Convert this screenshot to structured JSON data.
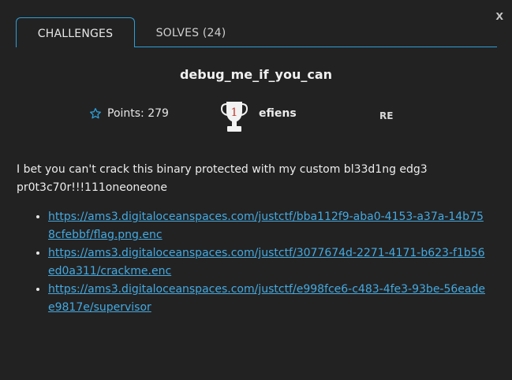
{
  "modal": {
    "close_label": "x",
    "tabs": [
      {
        "label": "CHALLENGES"
      },
      {
        "label": "SOLVES (24)"
      }
    ],
    "accent_color": "#2e9ed6",
    "challenge": {
      "name": "debug_me_if_you_can",
      "points_label": "Points: 279",
      "trophy_rank": "1",
      "author": "efiens",
      "category": "RE",
      "description": "I bet you can't crack this binary protected with my custom bl33d1ng edg3 pr0t3c70r!!!111oneoneone",
      "files": [
        "https://ams3.digitaloceanspaces.com/justctf/bba112f9-aba0-4153-a37a-14b758cfebbf/flag.png.enc",
        "https://ams3.digitaloceanspaces.com/justctf/3077674d-2271-4171-b623-f1b56ed0a311/crackme.enc",
        "https://ams3.digitaloceanspaces.com/justctf/e998fce6-c483-4fe3-93be-56eadee9817e/supervisor"
      ]
    }
  }
}
